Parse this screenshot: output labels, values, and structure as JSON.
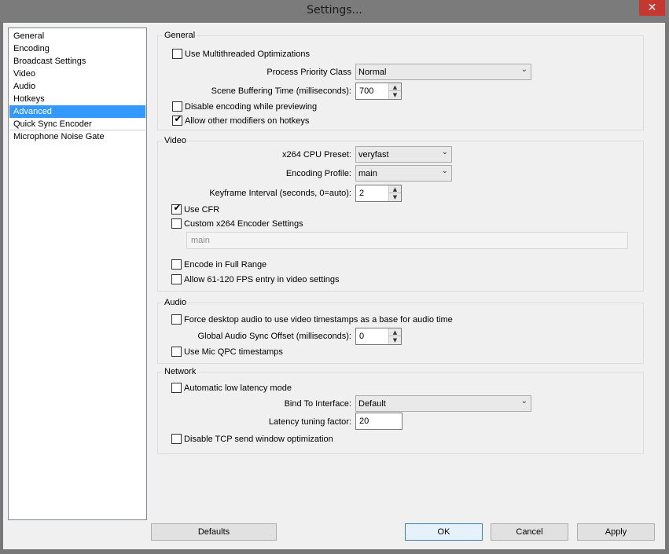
{
  "window": {
    "title": "Settings...",
    "close_glyph": "✕",
    "close_color": "#c7372f"
  },
  "sidebar": {
    "items": [
      {
        "label": "General",
        "selected": false
      },
      {
        "label": "Encoding",
        "selected": false
      },
      {
        "label": "Broadcast Settings",
        "selected": false
      },
      {
        "label": "Video",
        "selected": false
      },
      {
        "label": "Audio",
        "selected": false
      },
      {
        "label": "Hotkeys",
        "selected": false
      },
      {
        "label": "Advanced",
        "selected": true
      },
      {
        "label": "Quick Sync Encoder",
        "selected": false
      },
      {
        "label": "Microphone Noise Gate",
        "selected": false
      }
    ],
    "selected_color": "#3399ff"
  },
  "general": {
    "group_label": "General",
    "multithreaded_label": "Use Multithreaded Optimizations",
    "multithreaded_checked": false,
    "priority_label": "Process Priority Class",
    "priority_value": "Normal",
    "buffering_label": "Scene Buffering Time (milliseconds):",
    "buffering_value": "700",
    "disable_encoding_label": "Disable encoding while previewing",
    "disable_encoding_checked": false,
    "modifiers_label": "Allow other modifiers on hotkeys",
    "modifiers_checked": true
  },
  "video": {
    "group_label": "Video",
    "preset_label": "x264 CPU Preset:",
    "preset_value": "veryfast",
    "profile_label": "Encoding Profile:",
    "profile_value": "main",
    "keyframe_label": "Keyframe Interval (seconds, 0=auto):",
    "keyframe_value": "2",
    "cfr_label": "Use CFR",
    "cfr_checked": true,
    "custom_label": "Custom x264 Encoder Settings",
    "custom_checked": false,
    "custom_value": "main",
    "fullrange_label": "Encode in Full Range",
    "fullrange_checked": false,
    "fps_label": "Allow 61-120 FPS entry in video settings",
    "fps_checked": false
  },
  "audio": {
    "group_label": "Audio",
    "force_label": "Force desktop audio to use video timestamps as a base for audio time",
    "force_checked": false,
    "offset_label": "Global Audio Sync Offset (milliseconds):",
    "offset_value": "0",
    "qpc_label": "Use Mic QPC timestamps",
    "qpc_checked": false
  },
  "network": {
    "group_label": "Network",
    "latency_mode_label": "Automatic low latency mode",
    "latency_mode_checked": false,
    "bind_label": "Bind To Interface:",
    "bind_value": "Default",
    "tuning_label": "Latency tuning factor:",
    "tuning_value": "20",
    "tcp_label": "Disable TCP send window optimization",
    "tcp_checked": false
  },
  "footer": {
    "defaults_label": "Defaults",
    "ok_label": "OK",
    "cancel_label": "Cancel",
    "apply_label": "Apply"
  },
  "icons": {
    "check": "✔",
    "combo_arrow": "⌄",
    "spin_up": "▲",
    "spin_down": "▼"
  }
}
